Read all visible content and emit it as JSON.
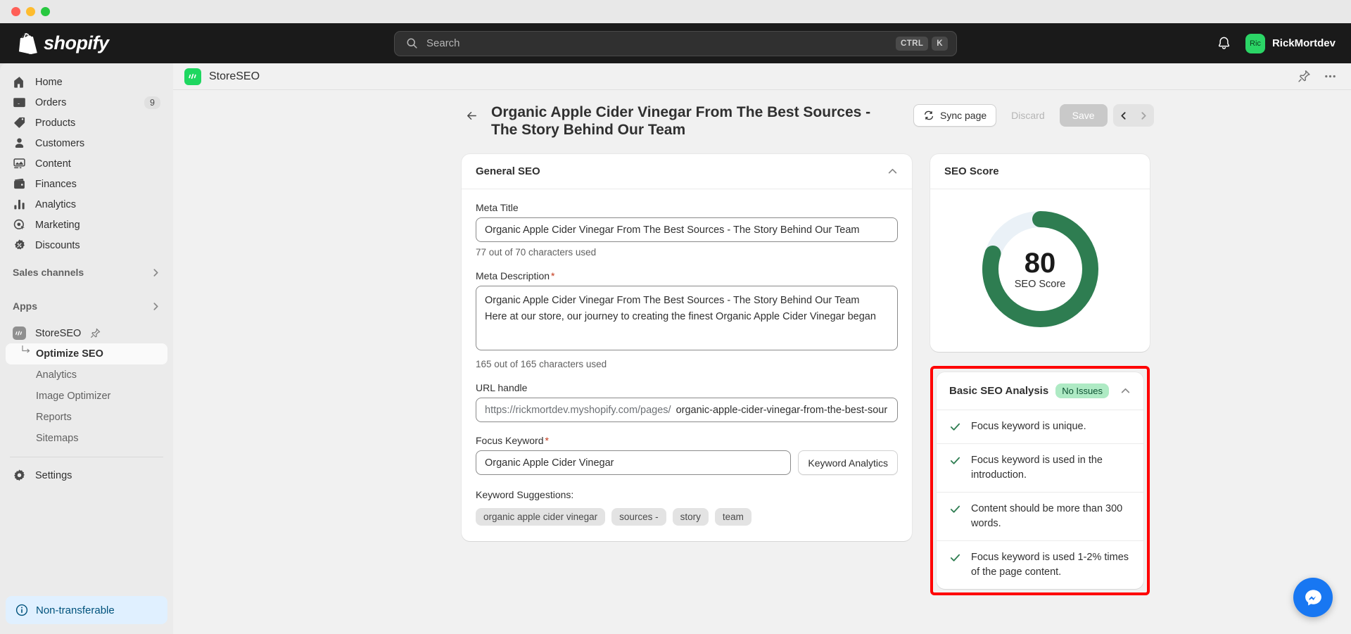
{
  "window": {
    "traffic_lights": [
      "close",
      "minimize",
      "maximize"
    ]
  },
  "topbar": {
    "brand": "shopify",
    "search": {
      "placeholder": "Search",
      "shortcut_primary": "CTRL",
      "shortcut_key": "K"
    },
    "notifications_icon": "bell-icon",
    "user": {
      "avatar_initials": "Ric",
      "name": "RickMortdev"
    }
  },
  "sidebar": {
    "nav": [
      {
        "label": "Home",
        "icon": "home-icon",
        "badge": ""
      },
      {
        "label": "Orders",
        "icon": "orders-icon",
        "badge": "9"
      },
      {
        "label": "Products",
        "icon": "products-tag-icon",
        "badge": ""
      },
      {
        "label": "Customers",
        "icon": "customers-person-icon",
        "badge": ""
      },
      {
        "label": "Content",
        "icon": "content-icon",
        "badge": ""
      },
      {
        "label": "Finances",
        "icon": "finances-wallet-icon",
        "badge": ""
      },
      {
        "label": "Analytics",
        "icon": "analytics-bars-icon",
        "badge": ""
      },
      {
        "label": "Marketing",
        "icon": "marketing-target-icon",
        "badge": ""
      },
      {
        "label": "Discounts",
        "icon": "discounts-icon",
        "badge": ""
      }
    ],
    "sections": [
      {
        "label": "Sales channels",
        "icon": "chevron-right-icon"
      },
      {
        "label": "Apps",
        "icon": "chevron-right-icon"
      }
    ],
    "app": {
      "label": "StoreSEO",
      "icon": "storeseo-icon",
      "pin_icon": "pin-icon"
    },
    "app_subitems": [
      {
        "label": "Optimize SEO",
        "active": true
      },
      {
        "label": "Analytics",
        "active": false
      },
      {
        "label": "Image Optimizer",
        "active": false
      },
      {
        "label": "Reports",
        "active": false
      },
      {
        "label": "Sitemaps",
        "active": false
      }
    ],
    "settings": {
      "label": "Settings",
      "icon": "gear-icon"
    },
    "footer": {
      "label": "Non-transferable",
      "icon": "info-circle-icon"
    }
  },
  "appbar": {
    "app_name": "StoreSEO",
    "app_icon": "storeseo-icon",
    "pin_icon": "pin-icon",
    "more_icon": "ellipsis-icon"
  },
  "page": {
    "back_icon": "arrow-left-icon",
    "title": "Organic Apple Cider Vinegar From The Best Sources - The Story Behind Our Team",
    "actions": {
      "sync_label": "Sync page",
      "sync_icon": "sync-icon",
      "discard_label": "Discard",
      "save_label": "Save",
      "prev_icon": "chevron-left-icon",
      "next_icon": "chevron-right-icon"
    }
  },
  "general_seo": {
    "card_title": "General SEO",
    "collapse_icon": "chevron-up-icon",
    "meta_title": {
      "label": "Meta Title",
      "value": "Organic Apple Cider Vinegar From The Best Sources - The Story Behind Our Team",
      "counter": "77 out of 70 characters used"
    },
    "meta_description": {
      "label": "Meta Description",
      "required_mark": "*",
      "value": "Organic Apple Cider Vinegar From The Best Sources - The Story Behind Our Team\nHere at our store, our journey to creating the finest Organic Apple Cider Vinegar began",
      "counter": "165 out of 165 characters used"
    },
    "url_handle": {
      "label": "URL handle",
      "prefix": "https://rickmortdev.myshopify.com/pages/",
      "value": "organic-apple-cider-vinegar-from-the-best-sour"
    },
    "focus_keyword": {
      "label": "Focus Keyword",
      "required_mark": "*",
      "value": "Organic Apple Cider Vinegar",
      "analytics_button": "Keyword Analytics"
    },
    "suggestions": {
      "label": "Keyword Suggestions:",
      "items": [
        "organic apple cider vinegar",
        "sources -",
        "story",
        "team"
      ]
    }
  },
  "seo_score": {
    "card_title": "SEO Score",
    "value": 80,
    "value_text": "80",
    "caption": "SEO Score",
    "arc_color": "#2e7d51",
    "track_color": "#eaf1f7"
  },
  "basic_seo_analysis": {
    "card_title": "Basic SEO Analysis",
    "status_badge": "No Issues",
    "collapse_icon": "chevron-up-icon",
    "highlight_color": "#ff0000",
    "checks": [
      {
        "icon": "check-icon",
        "text": "Focus keyword is unique."
      },
      {
        "icon": "check-icon",
        "text": "Focus keyword is used in the introduction."
      },
      {
        "icon": "check-icon",
        "text": "Content should be more than 300 words."
      },
      {
        "icon": "check-icon",
        "text": "Focus keyword is used 1-2% times of the page content."
      }
    ]
  },
  "chat": {
    "icon": "chat-bubble-icon",
    "color": "#1877f2"
  }
}
